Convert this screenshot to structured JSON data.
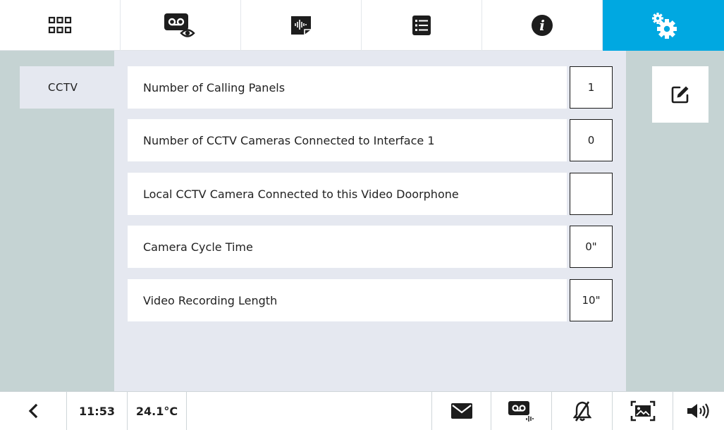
{
  "theme": {
    "accent": "#00a8e1"
  },
  "tabs": [
    {
      "icon": "grid-icon",
      "active": false
    },
    {
      "icon": "video-message-icon",
      "active": false
    },
    {
      "icon": "audio-file-icon",
      "active": false
    },
    {
      "icon": "list-icon",
      "active": false
    },
    {
      "icon": "info-icon",
      "active": false
    },
    {
      "icon": "settings-icon",
      "active": true
    }
  ],
  "sidebar": {
    "items": [
      {
        "label": "CCTV",
        "selected": true
      }
    ]
  },
  "settings": {
    "rows": [
      {
        "label": "Number of Calling Panels",
        "value": "1"
      },
      {
        "label": "Number of CCTV Cameras Connected to Interface 1",
        "value": "0"
      },
      {
        "label": "Local CCTV Camera Connected to this Video Doorphone",
        "value": ""
      },
      {
        "label": "Camera Cycle Time",
        "value": "0\""
      },
      {
        "label": "Video Recording Length",
        "value": "10\""
      }
    ]
  },
  "actions": {
    "edit_icon": "edit-icon"
  },
  "status": {
    "back_icon": "chevron-left-icon",
    "time": "11:53",
    "temperature": "24.1°C",
    "icons": [
      "envelope-icon",
      "video-answering-icon",
      "bell-muted-icon",
      "photo-frame-icon",
      "speaker-icon"
    ]
  }
}
